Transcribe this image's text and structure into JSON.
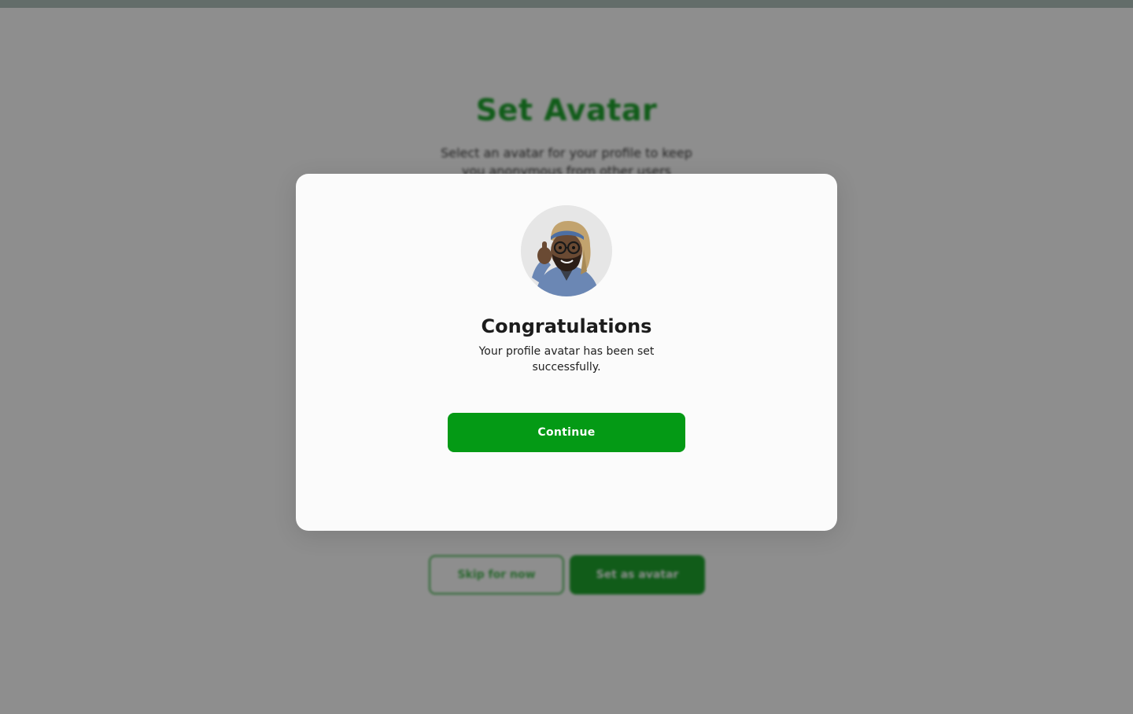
{
  "background": {
    "title": "Set Avatar",
    "subtitle": "Select an avatar for your profile to keep you anonymous from other users",
    "skip_label": "Skip for now",
    "set_avatar_label": "Set as avatar"
  },
  "modal": {
    "title": "Congratulations",
    "message": "Your profile avatar has been set successfully.",
    "continue_label": "Continue",
    "avatar_icon": "memoji-avatar"
  },
  "colors": {
    "accent": "#049a15",
    "overlay": "rgba(30,30,30,0.5)",
    "modal_bg": "#fbfbfb"
  }
}
